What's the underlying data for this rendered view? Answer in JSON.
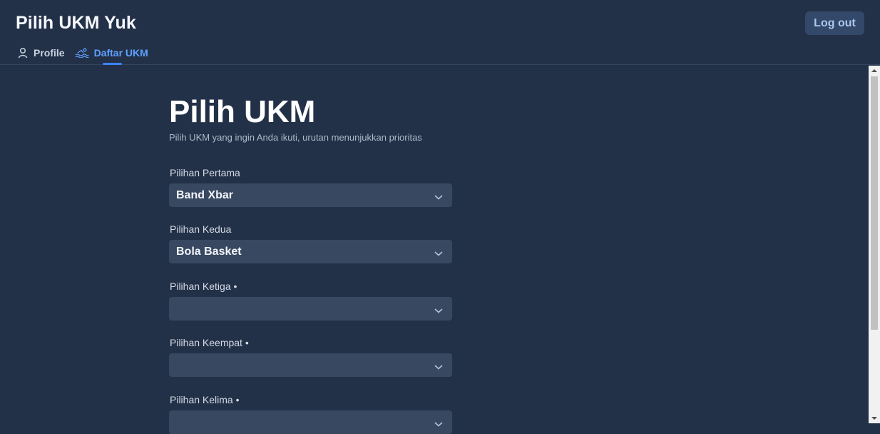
{
  "app": {
    "title": "Pilih UKM Yuk",
    "logout_label": "Log out"
  },
  "nav": {
    "items": [
      {
        "label": "Profile",
        "icon": "user-icon",
        "active": false
      },
      {
        "label": "Daftar UKM",
        "icon": "swimmer-icon",
        "active": true
      }
    ]
  },
  "page": {
    "title": "Pilih UKM",
    "subtitle": "Pilih UKM yang ingin Anda ikuti, urutan menunjukkan prioritas"
  },
  "form": {
    "fields": [
      {
        "label": "Pilihan Pertama",
        "value": "Band Xbar"
      },
      {
        "label": "Pilihan Kedua",
        "value": "Bola Basket"
      },
      {
        "label": "Pilihan Ketiga •",
        "value": ""
      },
      {
        "label": "Pilihan Keempat •",
        "value": ""
      },
      {
        "label": "Pilihan Kelima •",
        "value": ""
      }
    ]
  },
  "colors": {
    "background": "#233148",
    "select_bg": "#384861",
    "accent": "#3b82f6",
    "button_bg": "#34486a"
  }
}
